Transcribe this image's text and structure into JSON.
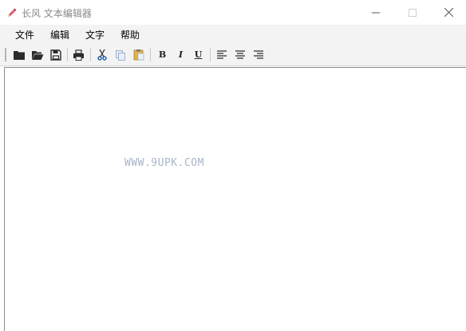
{
  "window": {
    "title": "长风 文本编辑器",
    "controls": {
      "minimize_glyph": "─",
      "maximize_glyph": "☐",
      "close_glyph": "✕"
    }
  },
  "menu": {
    "items": [
      {
        "label": "文件"
      },
      {
        "label": "编辑"
      },
      {
        "label": "文字"
      },
      {
        "label": "帮助"
      }
    ]
  },
  "toolbar": {
    "buttons": [
      {
        "icon": "new-file-icon"
      },
      {
        "icon": "open-folder-icon"
      },
      {
        "icon": "save-icon"
      },
      {
        "icon": "print-icon"
      },
      {
        "icon": "cut-icon"
      },
      {
        "icon": "copy-icon"
      },
      {
        "icon": "paste-icon"
      },
      {
        "icon": "bold-icon",
        "glyph": "B"
      },
      {
        "icon": "italic-icon",
        "glyph": "I"
      },
      {
        "icon": "underline-icon",
        "glyph": "U"
      },
      {
        "icon": "align-left-icon"
      },
      {
        "icon": "align-center-icon"
      },
      {
        "icon": "align-right-icon"
      }
    ]
  },
  "editor": {
    "watermark": "WWW.9UPK.COM"
  },
  "colors": {
    "menubar_bg": "#f3f3f3",
    "title_text": "#8a8a8a",
    "watermark": "#a8b4c8"
  }
}
